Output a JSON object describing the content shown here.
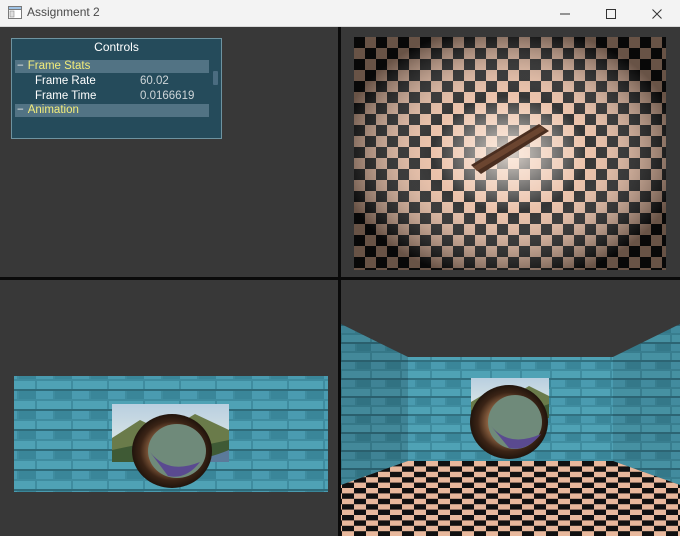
{
  "window": {
    "title": "Assignment 2",
    "buttons": [
      "minimize-icon",
      "maximize-icon",
      "close-icon"
    ]
  },
  "controls_panel": {
    "title": "Controls",
    "sections": [
      {
        "label": "Frame Stats",
        "expanded": true
      },
      {
        "label": "Animation",
        "expanded": true
      }
    ],
    "frame_rate_label": "Frame Rate",
    "frame_rate_value": "60.02",
    "frame_time_label": "Frame Time",
    "frame_time_value": "0.0166619"
  },
  "viewports": [
    {
      "name": "top-left",
      "content": "empty"
    },
    {
      "name": "top-right",
      "content": "checkerboard-floor-top-view"
    },
    {
      "name": "bottom-left",
      "content": "brick-wall-front-view"
    },
    {
      "name": "bottom-right",
      "content": "room-perspective-view"
    }
  ],
  "colors": {
    "viewport_background": "#383838",
    "panel_background": "#244d5e",
    "section_label": "#f2ec7a",
    "checker_light": "#e8b89c",
    "brick": "#3f8c9f"
  }
}
